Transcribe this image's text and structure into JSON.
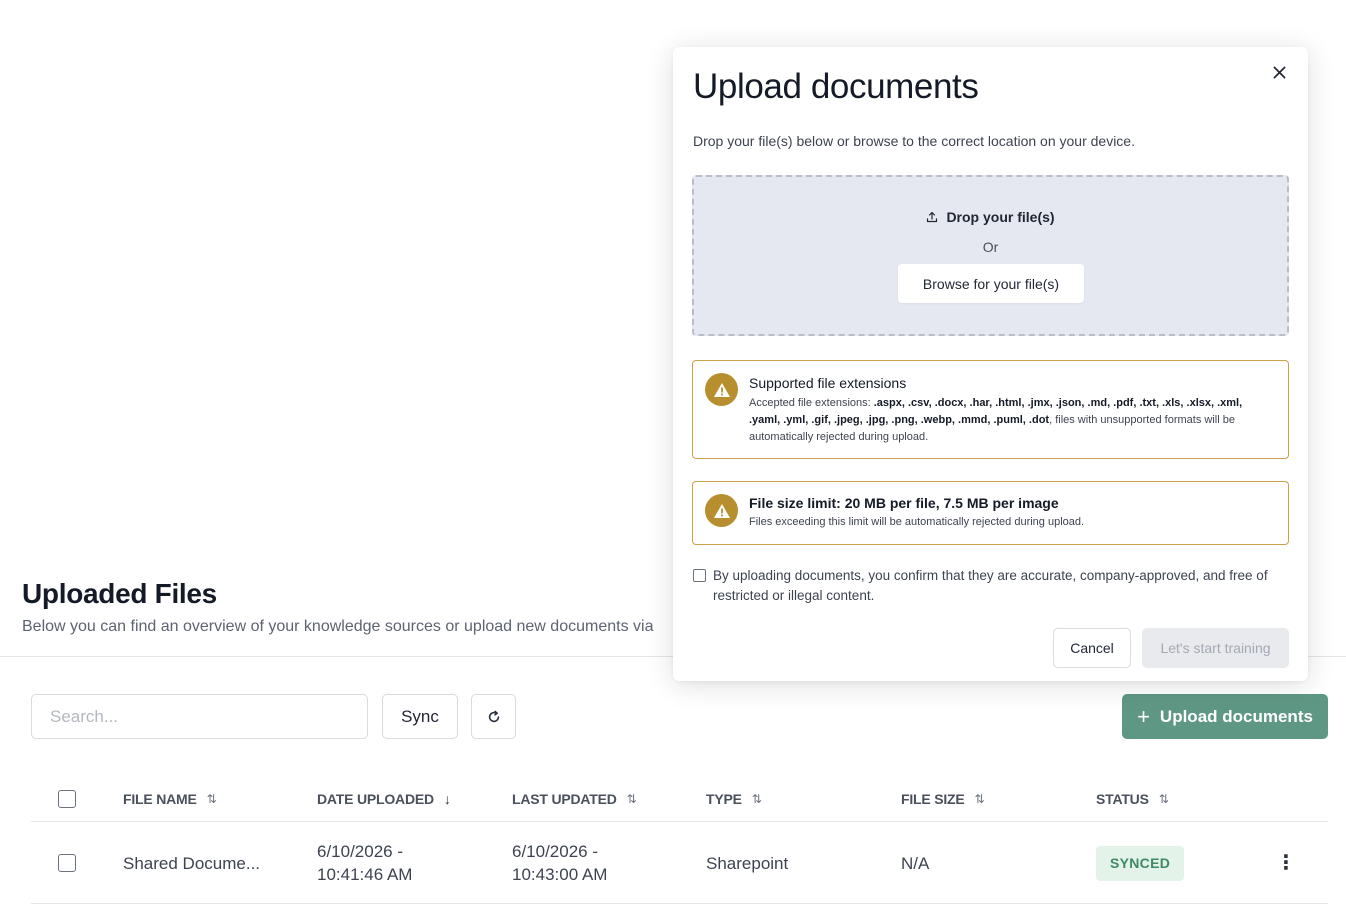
{
  "page": {
    "title": "Uploaded Files",
    "subtitle": "Below you can find an overview of your knowledge sources or upload new documents via"
  },
  "toolbar": {
    "search_placeholder": "Search...",
    "search_value": "",
    "sync_label": "Sync",
    "refresh_icon": "refresh-icon",
    "upload_label": "Upload documents",
    "upload_icon": "plus-icon"
  },
  "table": {
    "columns": [
      {
        "label": "FILE NAME",
        "sort": "unsorted"
      },
      {
        "label": "DATE UPLOADED",
        "sort": "descending"
      },
      {
        "label": "LAST UPDATED",
        "sort": "unsorted"
      },
      {
        "label": "TYPE",
        "sort": "unsorted"
      },
      {
        "label": "FILE SIZE",
        "sort": "unsorted"
      },
      {
        "label": "STATUS",
        "sort": "unsorted"
      }
    ],
    "rows": [
      {
        "file_name": "Shared Docume...",
        "date_uploaded_date": "6/10/2026 -",
        "date_uploaded_time": "10:41:46 AM",
        "last_updated_date": "6/10/2026 -",
        "last_updated_time": "10:43:00 AM",
        "type": "Sharepoint",
        "file_size": "N/A",
        "status": "SYNCED"
      }
    ]
  },
  "modal": {
    "title": "Upload documents",
    "description": "Drop your file(s) below or browse to the correct location on your device.",
    "dropzone": {
      "drop_label": "Drop your file(s)",
      "or_label": "Or",
      "browse_label": "Browse for your file(s)"
    },
    "extensions_warning": {
      "title": "Supported file extensions",
      "prefix": "Accepted file extensions: ",
      "extensions": ".aspx, .csv, .docx, .har, .html, .jmx, .json, .md, .pdf, .txt, .xls, .xlsx, .xml, .yaml, .yml, .gif, .jpeg, .jpg, .png, .webp, .mmd, .puml, .dot",
      "suffix": ", files with unsupported formats will be automatically rejected during upload."
    },
    "size_warning": {
      "title": "File size limit: 20 MB per file, 7.5 MB per image",
      "text": "Files exceeding this limit will be automatically rejected during upload."
    },
    "consent_text": "By uploading documents, you confirm that they are accurate, company-approved, and free of restricted or illegal content.",
    "consent_checked": false,
    "cancel_label": "Cancel",
    "start_label": "Let's start training"
  },
  "colors": {
    "accent": "#5f9785",
    "warning": "#b88f2e",
    "status_synced_bg": "#e3f3ea",
    "status_synced_text": "#3f8a63"
  }
}
